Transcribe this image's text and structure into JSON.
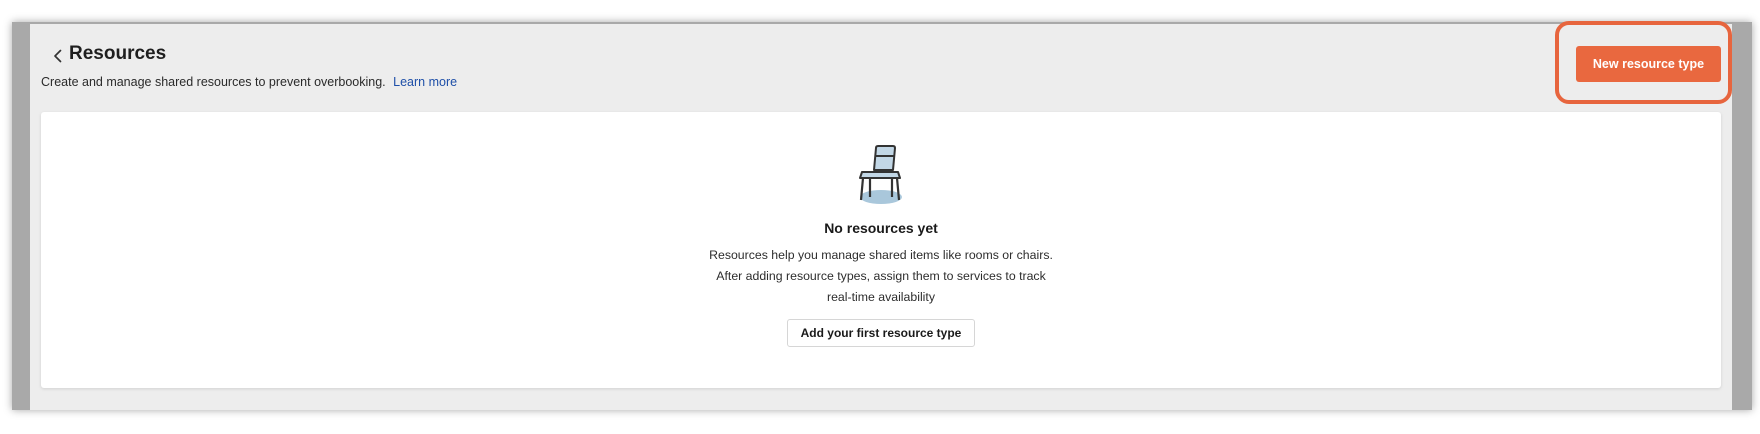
{
  "header": {
    "title": "Resources",
    "subtitle": "Create and manage shared resources to prevent overbooking.",
    "learn_more": "Learn more",
    "new_resource_button": "New resource type"
  },
  "empty_state": {
    "icon": "chair-icon",
    "title": "No resources yet",
    "line1": "Resources help you manage shared items like rooms or chairs.",
    "line2": "After adding resource types, assign them to services to track",
    "line3": "real-time availability",
    "cta_button": "Add your first resource type"
  },
  "colors": {
    "accent": "#e9683f",
    "highlight": "#e7653e",
    "link": "#1e4fa8",
    "page_background": "#ededed"
  }
}
